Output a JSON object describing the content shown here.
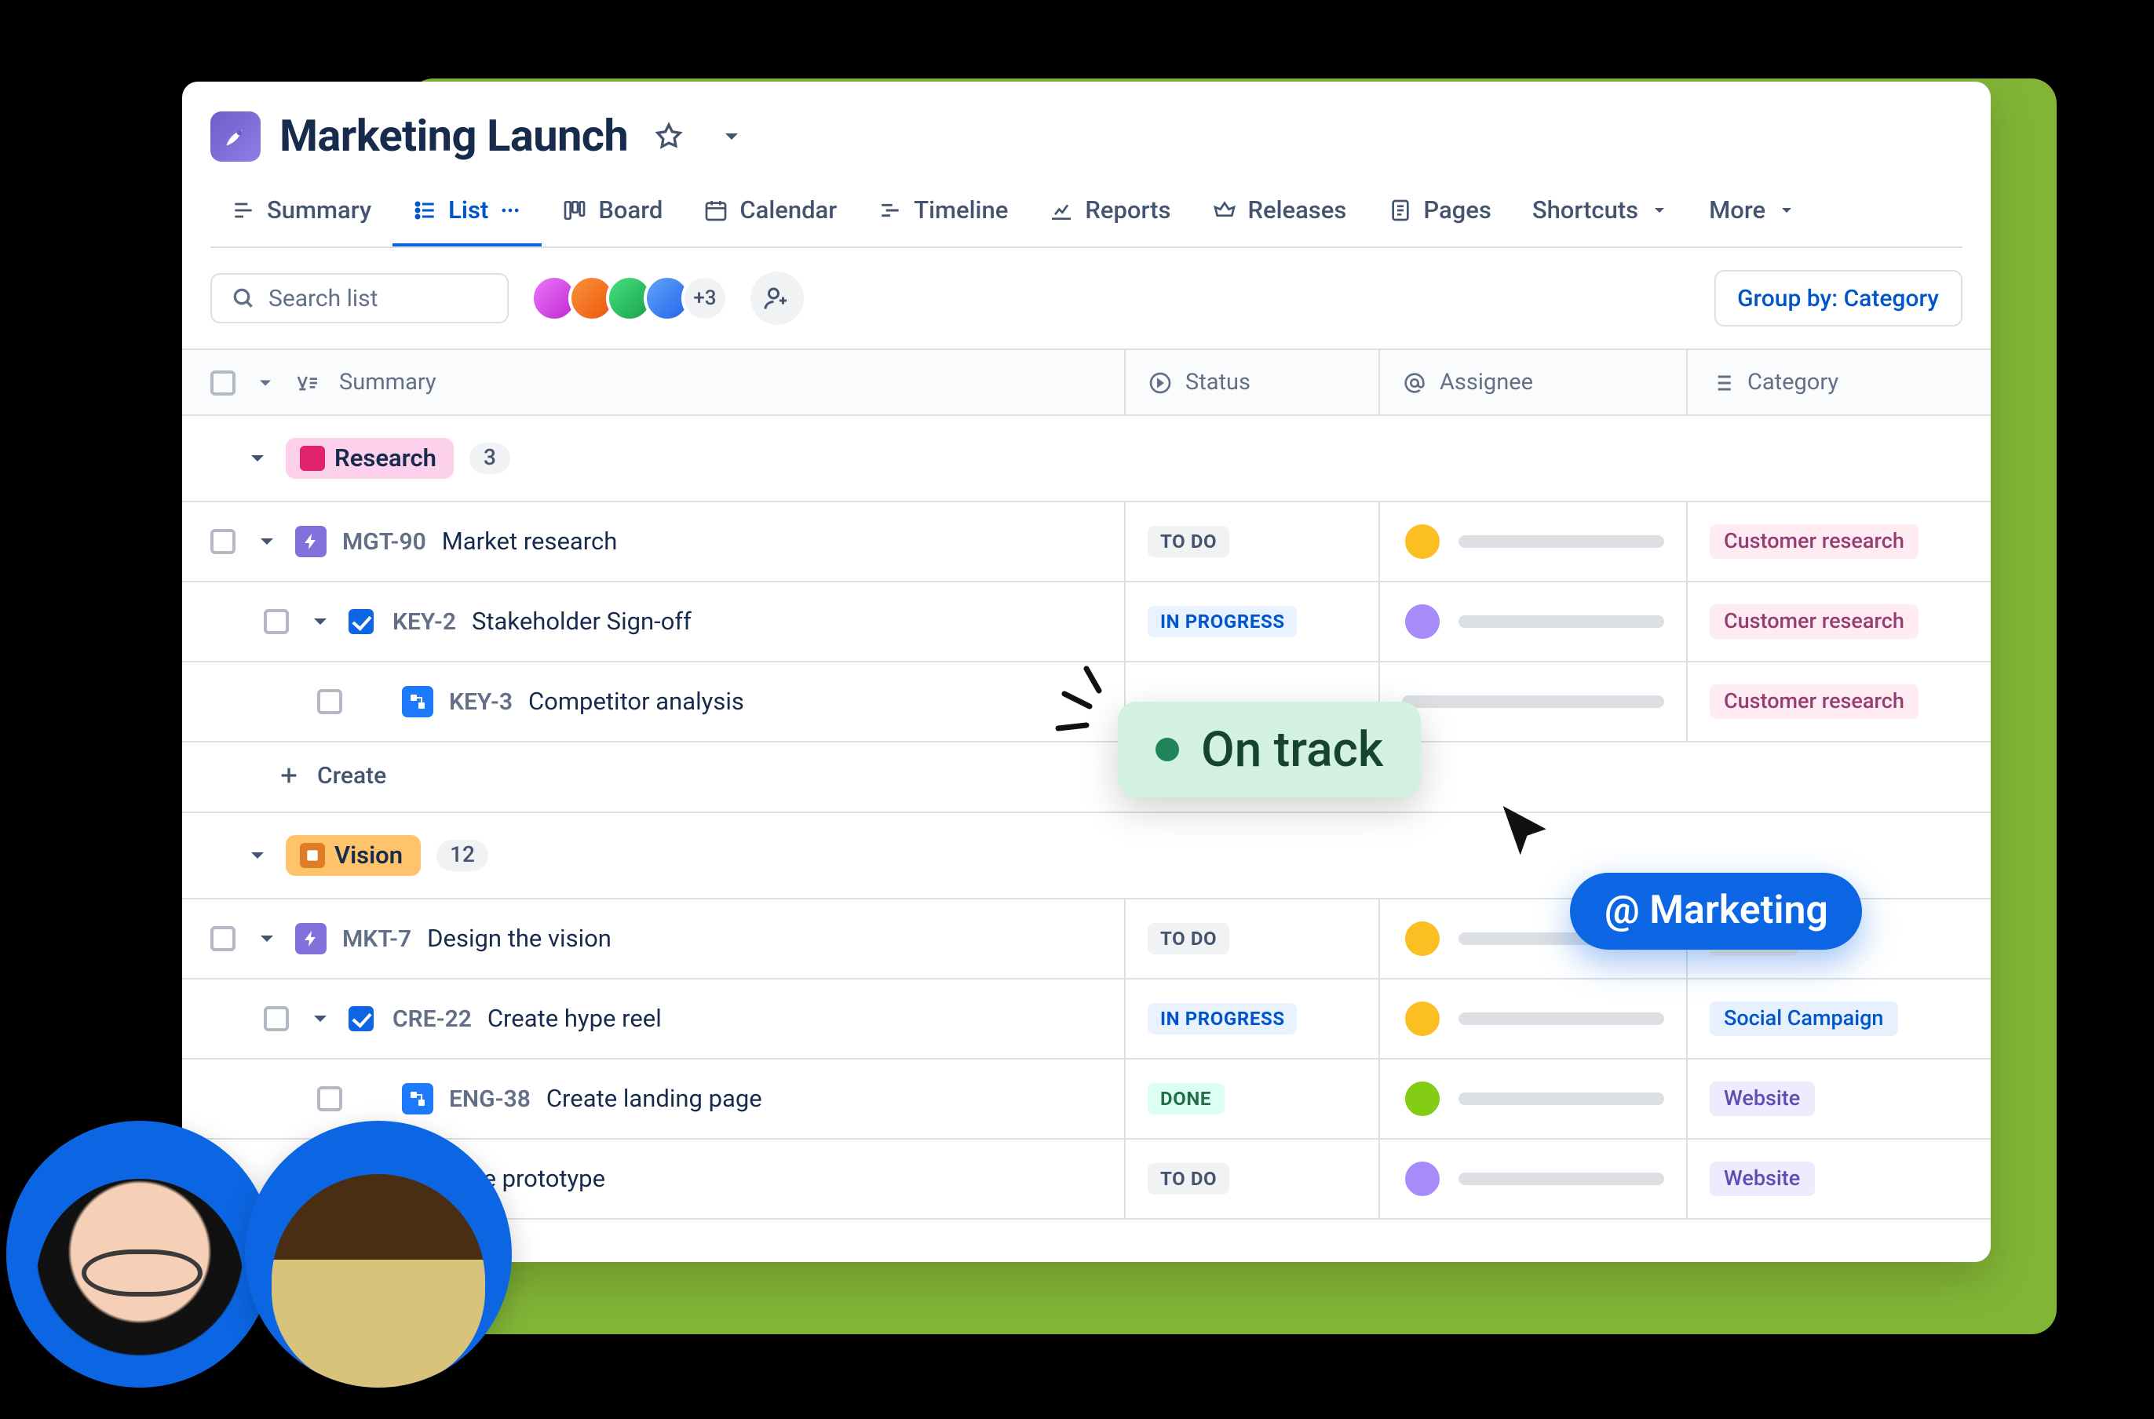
{
  "project": {
    "title": "Marketing Launch"
  },
  "tabs": [
    {
      "label": "Summary"
    },
    {
      "label": "List"
    },
    {
      "label": "Board"
    },
    {
      "label": "Calendar"
    },
    {
      "label": "Timeline"
    },
    {
      "label": "Reports"
    },
    {
      "label": "Releases"
    },
    {
      "label": "Pages"
    },
    {
      "label": "Shortcuts"
    },
    {
      "label": "More"
    }
  ],
  "search_placeholder": "Search list",
  "avatars_extra": "+3",
  "group_by": {
    "prefix": "Group by: ",
    "value": "Category"
  },
  "columns": {
    "summary": "Summary",
    "status": "Status",
    "assignee": "Assignee",
    "category": "Category"
  },
  "groups": [
    {
      "id": "research",
      "label": "Research",
      "color": "#FDD0EC",
      "text": "#172B4D",
      "icon_bg": "#E2226C",
      "count": "3",
      "rows": [
        {
          "indent": 1,
          "expand": true,
          "checked": false,
          "type": "epic",
          "key": "MGT-90",
          "name": "Market research",
          "status": "TO DO",
          "status_cls": "st-todo",
          "av": "#FBBF24",
          "cat": "Customer research",
          "cat_cls": "cat-research"
        },
        {
          "indent": 2,
          "expand": true,
          "checked": true,
          "type": "task",
          "key": "KEY-2",
          "name": "Stakeholder Sign-off",
          "status": "IN PROGRESS",
          "status_cls": "st-progress",
          "av": "#A78BFA",
          "cat": "Customer research",
          "cat_cls": "cat-research"
        },
        {
          "indent": 3,
          "expand": false,
          "checked": false,
          "type": "subtask",
          "key": "KEY-3",
          "name": "Competitor analysis",
          "status": "",
          "status_cls": "",
          "av": "",
          "cat": "Customer research",
          "cat_cls": "cat-research"
        }
      ],
      "create": "Create"
    },
    {
      "id": "vision",
      "label": "Vision",
      "color": "#FFC46B",
      "text": "#172B4D",
      "icon_bg": "#E07C24",
      "count": "12",
      "rows": [
        {
          "indent": 1,
          "expand": true,
          "checked": false,
          "type": "epic",
          "key": "MKT-7",
          "name": "Design the vision",
          "status": "TO DO",
          "status_cls": "st-todo",
          "av": "#FBBF24",
          "cat": "Vision",
          "cat_cls": "cat-vision"
        },
        {
          "indent": 2,
          "expand": true,
          "checked": true,
          "type": "task",
          "key": "CRE-22",
          "name": "Create hype reel",
          "status": "IN PROGRESS",
          "status_cls": "st-progress",
          "av": "#FBBF24",
          "cat": "Social Campaign",
          "cat_cls": "cat-social"
        },
        {
          "indent": 3,
          "expand": false,
          "checked": false,
          "type": "subtask",
          "key": "ENG-38",
          "name": "Create landing page",
          "status": "DONE",
          "status_cls": "st-done",
          "av": "#84CC16",
          "cat": "Website",
          "cat_cls": "cat-website"
        },
        {
          "indent": 3,
          "expand": false,
          "checked": false,
          "type": "subtask",
          "key": "",
          "name": "eate prototype",
          "status": "TO DO",
          "status_cls": "st-todo",
          "av": "#A78BFA",
          "cat": "Website",
          "cat_cls": "cat-website"
        }
      ]
    }
  ],
  "ontrack_label": "On track",
  "marketing_pill": "@ Marketing"
}
